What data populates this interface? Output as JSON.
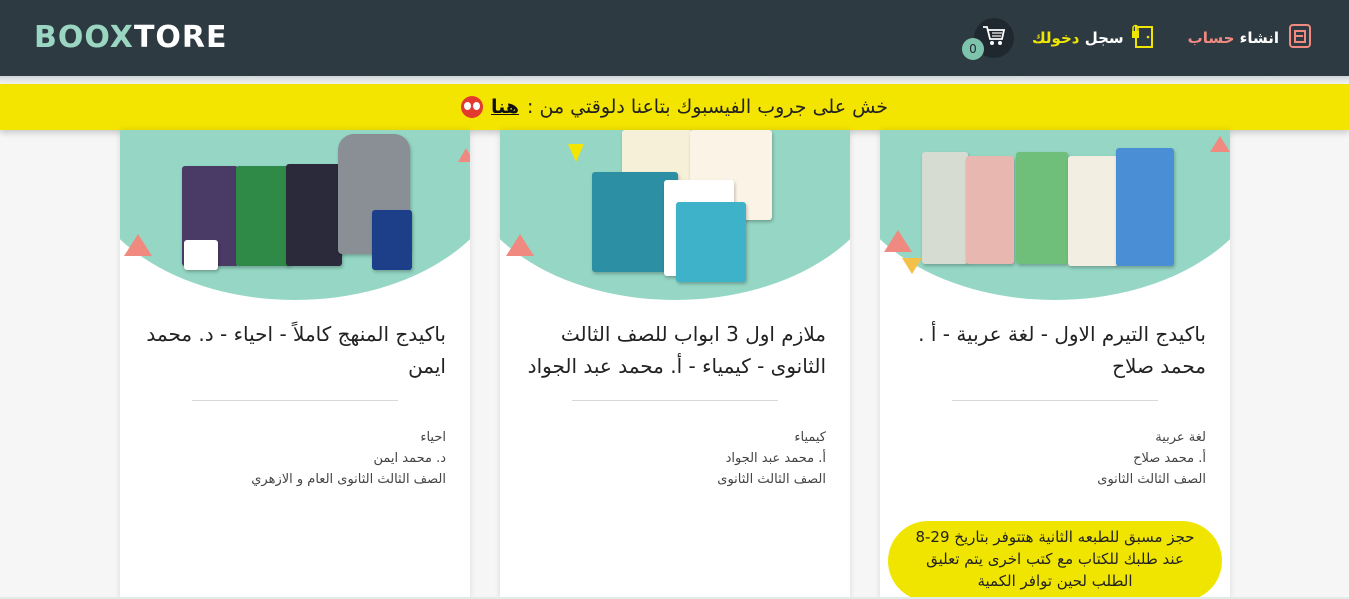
{
  "header": {
    "logo_part1": "BOOX",
    "logo_part2": "TORE",
    "cart_count": "0",
    "login_prefix": "سجل ",
    "login_highlight": "دخولك",
    "signup_prefix": "انشاء ",
    "signup_highlight": "حساب"
  },
  "banner": {
    "text": "خش على جروب الفيسبوك بتاعنا دلوقتي من :",
    "link": "هنا"
  },
  "cards": [
    {
      "title": "باكيدج التيرم الاول - لغة عربية - أ . محمد صلاح",
      "subject": "لغة عربية",
      "teacher": "أ. محمد صلاح",
      "grade": "الصف الثالث الثانوى",
      "note": "حجز مسبق للطبعه الثانية هتتوفر بتاريخ 29-8 عند طلبك للكتاب مع كتب اخرى يتم تعليق الطلب لحين توافر الكمية"
    },
    {
      "title": "ملازم اول 3 ابواب للصف الثالث الثانوى - كيمياء - أ. محمد عبد الجواد",
      "subject": "كيمياء",
      "teacher": "أ. محمد عبد الجواد",
      "grade": "الصف الثالث الثانوى"
    },
    {
      "title": "باكيدج المنهج كاملاً - احياء - د. محمد ايمن",
      "subject": "احياء",
      "teacher": "د. محمد ايمن",
      "grade": "الصف الثالث الثانوى العام و الازهري"
    }
  ],
  "colors": {
    "header_bg": "#2e3a42",
    "banner_bg": "#f4e500",
    "accent_teal": "#95d7c4",
    "accent_coral": "#f08a80"
  }
}
